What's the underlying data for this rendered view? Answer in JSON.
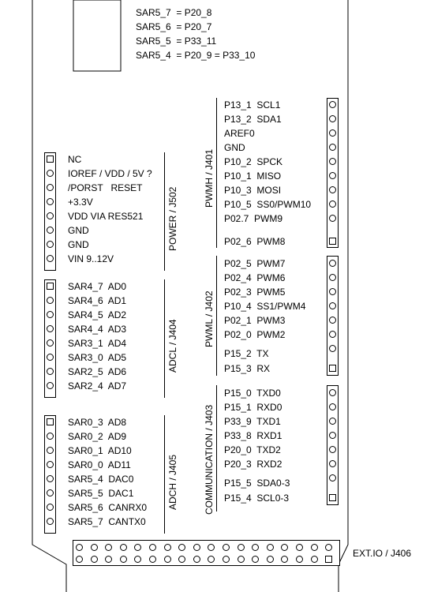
{
  "top_labels": [
    "SAR5_7  = P20_8",
    "SAR5_6  = P20_7",
    "SAR5_5  = P33_11",
    "SAR5_4  = P20_9 = P33_10"
  ],
  "power": {
    "title": "POWER / J502",
    "pins": [
      "NC",
      "IOREF / VDD / 5V ?",
      "/PORST   RESET",
      "+3.3V",
      "VDD VIA RES521",
      "GND",
      "GND",
      "VIN 9..12V"
    ]
  },
  "adcl": {
    "title": "ADCL / J404",
    "pins": [
      "SAR4_7  AD0",
      "SAR4_6  AD1",
      "SAR4_5  AD2",
      "SAR4_4  AD3",
      "SAR3_1  AD4",
      "SAR3_0  AD5",
      "SAR2_5  AD6",
      "SAR2_4  AD7"
    ]
  },
  "adch": {
    "title": "ADCH / J405",
    "pins": [
      "SAR0_3  AD8",
      "SAR0_2  AD9",
      "SAR0_1  AD10",
      "SAR0_0  AD11",
      "SAR5_4  DAC0",
      "SAR5_5  DAC1",
      "SAR5_6  CANRX0",
      "SAR5_7  CANTX0"
    ]
  },
  "pwmh": {
    "title": "PWMH / J401",
    "pins": [
      "P13_1  SCL1",
      "P13_2  SDA1",
      "AREF0",
      "GND",
      "P10_2  SPCK",
      "P10_1  MISO",
      "P10_3  MOSI",
      "P10_5  SS0/PWM10",
      "P02.7  PWM9",
      "P02_6  PWM8"
    ]
  },
  "pwml": {
    "title": "PWML / J402",
    "pins": [
      "P02_5  PWM7",
      "P02_4  PWM6",
      "P02_3  PWM5",
      "P10_4  SS1/PWM4",
      "P02_1  PWM3",
      "P02_0  PWM2",
      "P15_2  TX",
      "P15_3  RX"
    ]
  },
  "comm": {
    "title": "COMMUNICATION / J403",
    "pins": [
      "P15_0  TXD0",
      "P15_1  RXD0",
      "P33_9  TXD1",
      "P33_8  RXD1",
      "P20_0  TXD2",
      "P20_3  RXD2",
      "P15_5  SDA0-3",
      "P15_4  SCL0-3"
    ]
  },
  "extio": {
    "title": "EXT.IO / J406"
  }
}
